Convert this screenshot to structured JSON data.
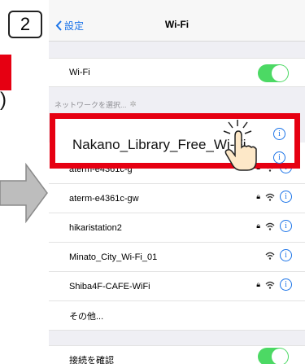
{
  "step": {
    "number": "2"
  },
  "nav": {
    "back_label": "設定",
    "title": "Wi-Fi"
  },
  "wifi_row": {
    "label": "Wi-Fi",
    "on": true
  },
  "section": {
    "header": "ネットワークを選択..."
  },
  "highlight": {
    "ssid": "Nakano_Library_Free_Wi-Fi"
  },
  "networks": [
    {
      "name": "aterm-e4361c-g",
      "locked": true
    },
    {
      "name": "aterm-e4361c-gw",
      "locked": true
    },
    {
      "name": "hikaristation2",
      "locked": true
    },
    {
      "name": "Minato_City_Wi-Fi_01",
      "locked": false
    },
    {
      "name": "Shiba4F-CAFE-WiFi",
      "locked": true
    }
  ],
  "other": {
    "label": "その他..."
  },
  "ask_join": {
    "label": "接続を確認",
    "on": true
  },
  "colors": {
    "accent": "#1a73e8",
    "toggle_on": "#4cd964",
    "highlight": "#e60012"
  }
}
